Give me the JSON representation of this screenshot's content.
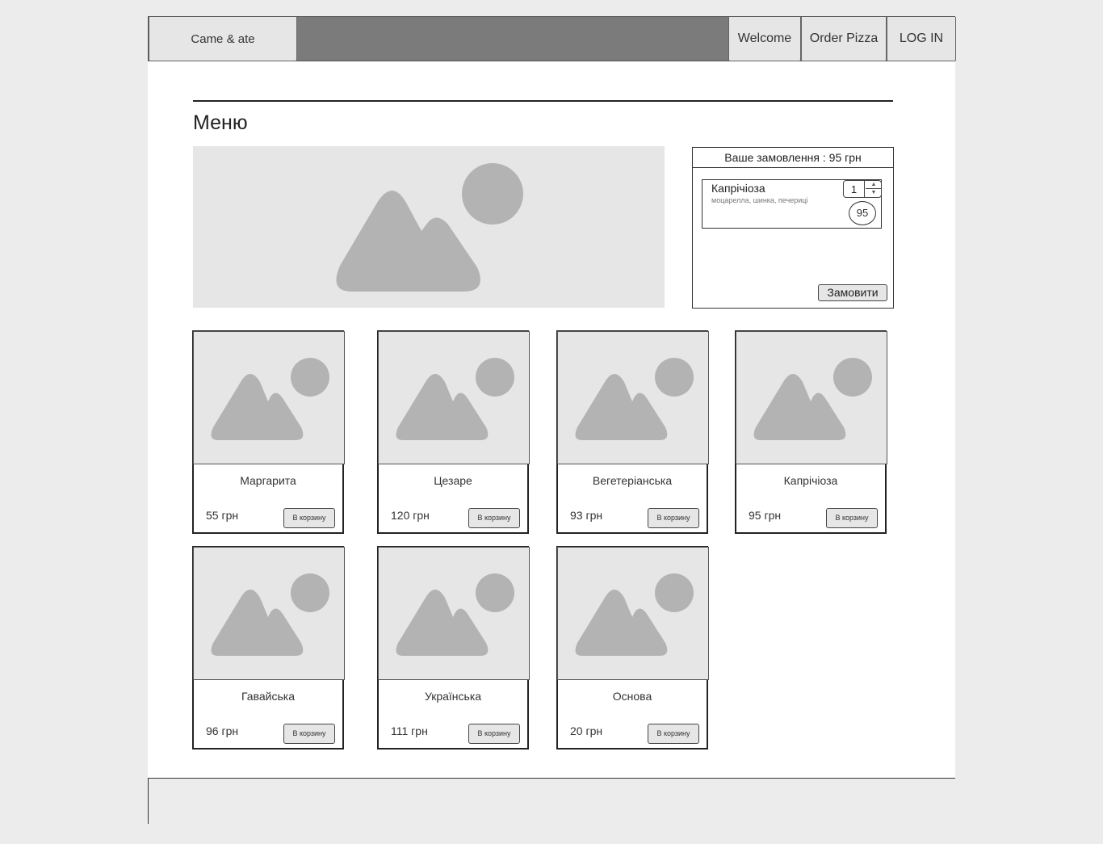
{
  "nav": {
    "brand": "Came & ate",
    "welcome": "Welcome",
    "order_pizza": "Order Pizza",
    "login": "LOG IN"
  },
  "page_title": "Меню",
  "order_panel": {
    "header": "Ваше замовлення : 95 грн",
    "item": {
      "name": "Капрічіоза",
      "ingredients": "моцарелла, шинка, печериці",
      "quantity": "1",
      "price": "95"
    },
    "submit": "Замовити"
  },
  "menu": [
    {
      "name": "Маргарита",
      "price": "55 грн",
      "button": "В корзину"
    },
    {
      "name": "Цезаре",
      "price": "120 грн",
      "button": "В корзину"
    },
    {
      "name": "Вегетеріанська",
      "price": "93 грн",
      "button": "В корзину"
    },
    {
      "name": "Капрічіоза",
      "price": "95 грн",
      "button": "В корзину"
    },
    {
      "name": "Гавайська",
      "price": "96 грн",
      "button": "В корзину"
    },
    {
      "name": "Українська",
      "price": "111 грн",
      "button": "В корзину"
    },
    {
      "name": "Основа",
      "price": "20 грн",
      "button": "В корзину"
    }
  ],
  "colors": {
    "navbar": "#7b7b7b",
    "button_bg": "#e6e6e6",
    "placeholder_bg": "#e6e6e6",
    "placeholder_shape": "#b3b3b3"
  }
}
